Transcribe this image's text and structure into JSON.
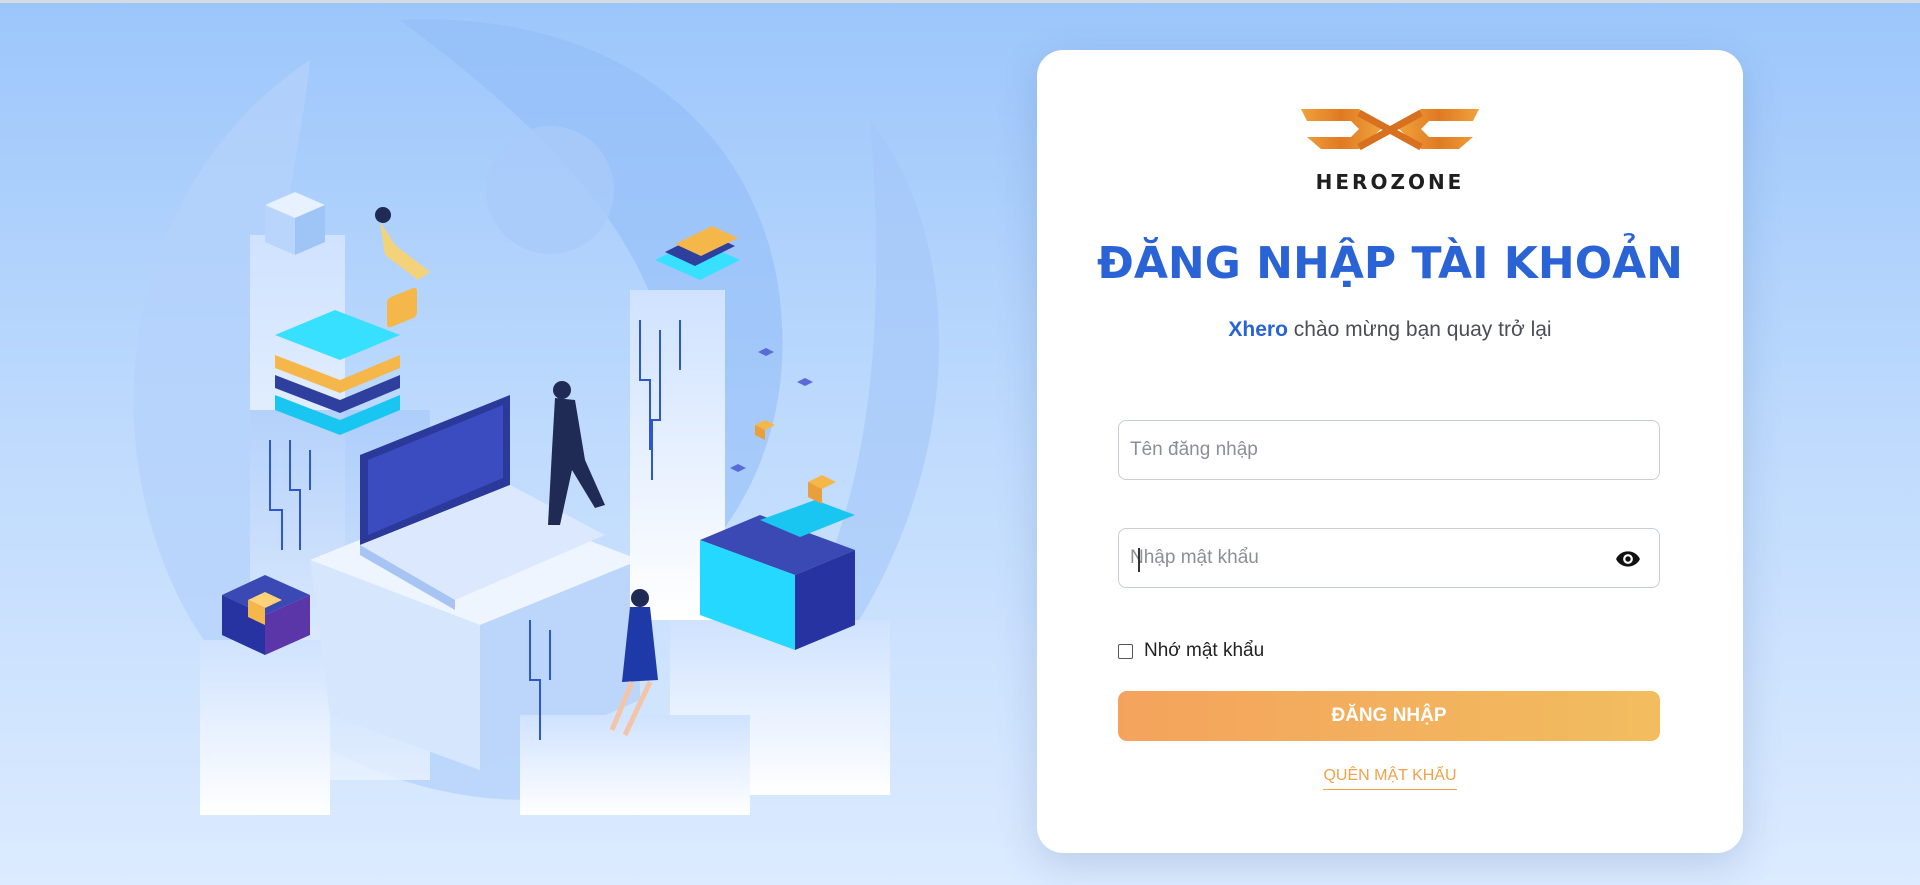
{
  "brand": {
    "name": "HEROZONE"
  },
  "login": {
    "title": "ĐĂNG NHẬP TÀI KHOẢN",
    "welcome_highlight": "Xhero",
    "welcome_text": " chào mừng bạn quay trở lại",
    "username_placeholder": "Tên đăng nhập",
    "password_placeholder": "Nhập mật khẩu",
    "remember_label": "Nhớ mật khẩu",
    "remember_checked": false,
    "submit_label": "ĐĂNG NHẬP",
    "forgot_label": "QUÊN MẬT KHẨU"
  },
  "icons": {
    "password_toggle": "eye-icon"
  },
  "colors": {
    "title": "#2a63d6",
    "button_start": "#f4a35c",
    "button_end": "#f2bd5f",
    "forgot_link": "#f0a24a",
    "background": "#9cc6fb"
  }
}
